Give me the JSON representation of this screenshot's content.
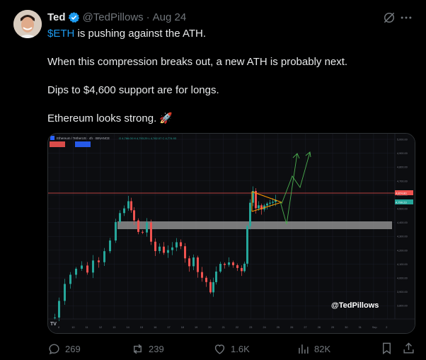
{
  "tweet": {
    "name": "Ted",
    "handle": "@TedPillows",
    "separator": "·",
    "time": "Aug 24",
    "cashtag": "$ETH",
    "line1_rest": " is pushing against the ATH.",
    "line2": "When this compression breaks out, a new ATH is probably next.",
    "line3": "Dips to $4,600 support are for longs.",
    "line4": "Ethereum looks strong.",
    "rocket_emoji": "🚀"
  },
  "media": {
    "watermark": "@TedPillows",
    "chart_header": "Ethereum / TetherUS · 4h · BINANCE",
    "price_tag_red": "4,874.80",
    "price_tag_green": "4,799.23",
    "y_ticks": [
      "5,000.00",
      "4,900.00",
      "4,800.00",
      "4,700.00",
      "4,600.00",
      "4,500.00",
      "4,400.00",
      "4,300.00",
      "4,200.00",
      "4,100.00",
      "4,000.00",
      "3,900.00",
      "3,800.00"
    ],
    "x_ticks": [
      "8",
      "10",
      "11",
      "12",
      "13",
      "14",
      "15",
      "16",
      "17",
      "18",
      "19",
      "20",
      "21",
      "22",
      "23",
      "24",
      "25",
      "26",
      "27",
      "28",
      "29",
      "30",
      "31",
      "Sep",
      "2"
    ],
    "colors": {
      "bull": "#26a69a",
      "bear": "#ef5350",
      "ath_line": "#ef5350",
      "support_band": "#9e9e9e",
      "projection": "#4caf50",
      "triangle": "#ff9800"
    }
  },
  "actions": {
    "replies": "269",
    "reposts": "239",
    "likes": "1.6K",
    "views": "82K"
  }
}
